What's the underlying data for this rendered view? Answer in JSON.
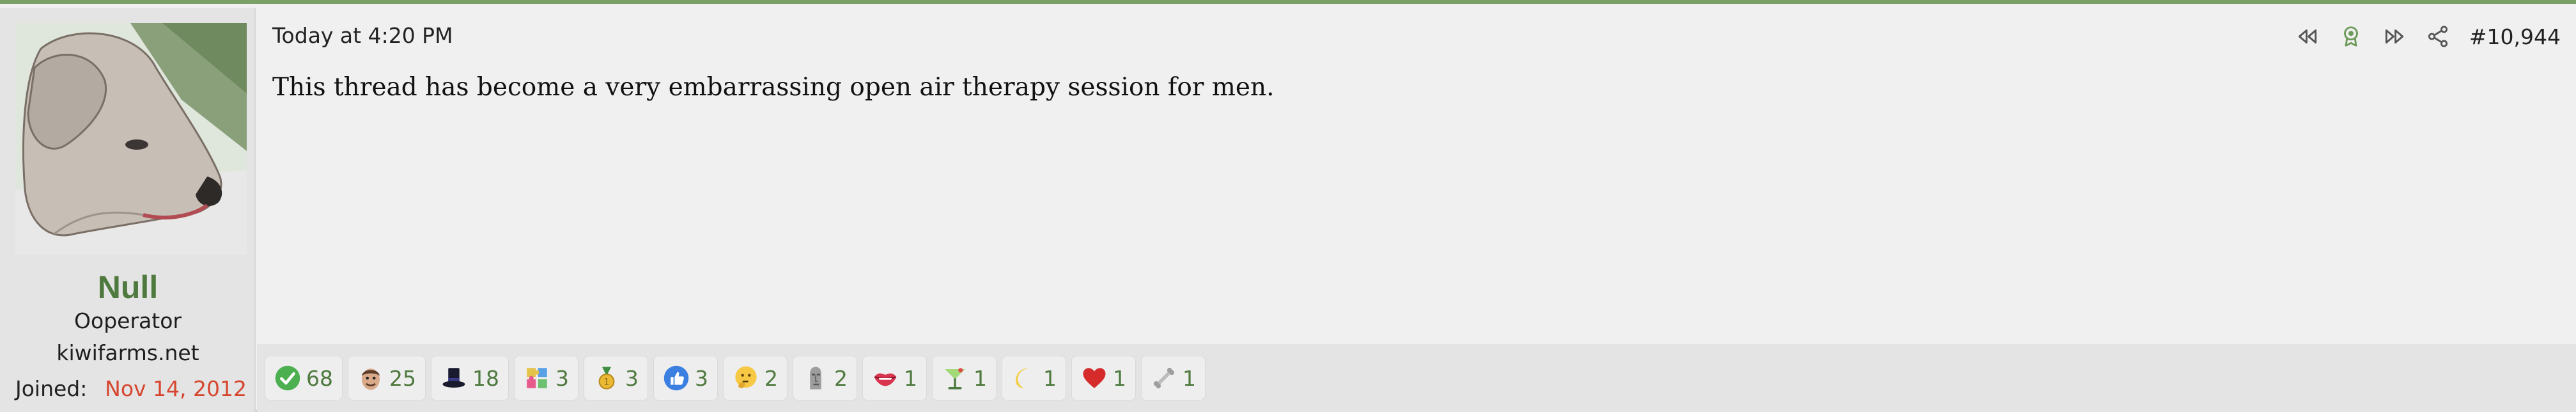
{
  "user": {
    "name": "Null",
    "title_line1": "Ooperator",
    "title_line2": "kiwifarms.net",
    "joined_label": "Joined:",
    "joined_value": "Nov 14, 2012"
  },
  "post": {
    "date": "Today at 4:20 PM",
    "number": "#10,944",
    "body": "This thread has become a very embarrassing open air therapy session for men."
  },
  "header_icons": [
    "rewind-icon",
    "award-icon",
    "fast-forward-icon",
    "share-icon"
  ],
  "reactions": [
    {
      "icon": "checkmark-icon",
      "count": "68"
    },
    {
      "icon": "face-icon",
      "count": "25"
    },
    {
      "icon": "top-hat-icon",
      "count": "18"
    },
    {
      "icon": "puzzle-icon",
      "count": "3"
    },
    {
      "icon": "medal-icon",
      "count": "3"
    },
    {
      "icon": "thumbs-up-icon",
      "count": "3"
    },
    {
      "icon": "thinking-icon",
      "count": "2"
    },
    {
      "icon": "moai-icon",
      "count": "2"
    },
    {
      "icon": "lips-icon",
      "count": "1"
    },
    {
      "icon": "cocktail-icon",
      "count": "1"
    },
    {
      "icon": "moon-icon",
      "count": "1"
    },
    {
      "icon": "heart-icon",
      "count": "1"
    },
    {
      "icon": "bone-icon",
      "count": "1"
    }
  ],
  "colors": {
    "accent": "#4f7a3f",
    "joined_date": "#d6462f",
    "top_border": "#7aa067"
  }
}
